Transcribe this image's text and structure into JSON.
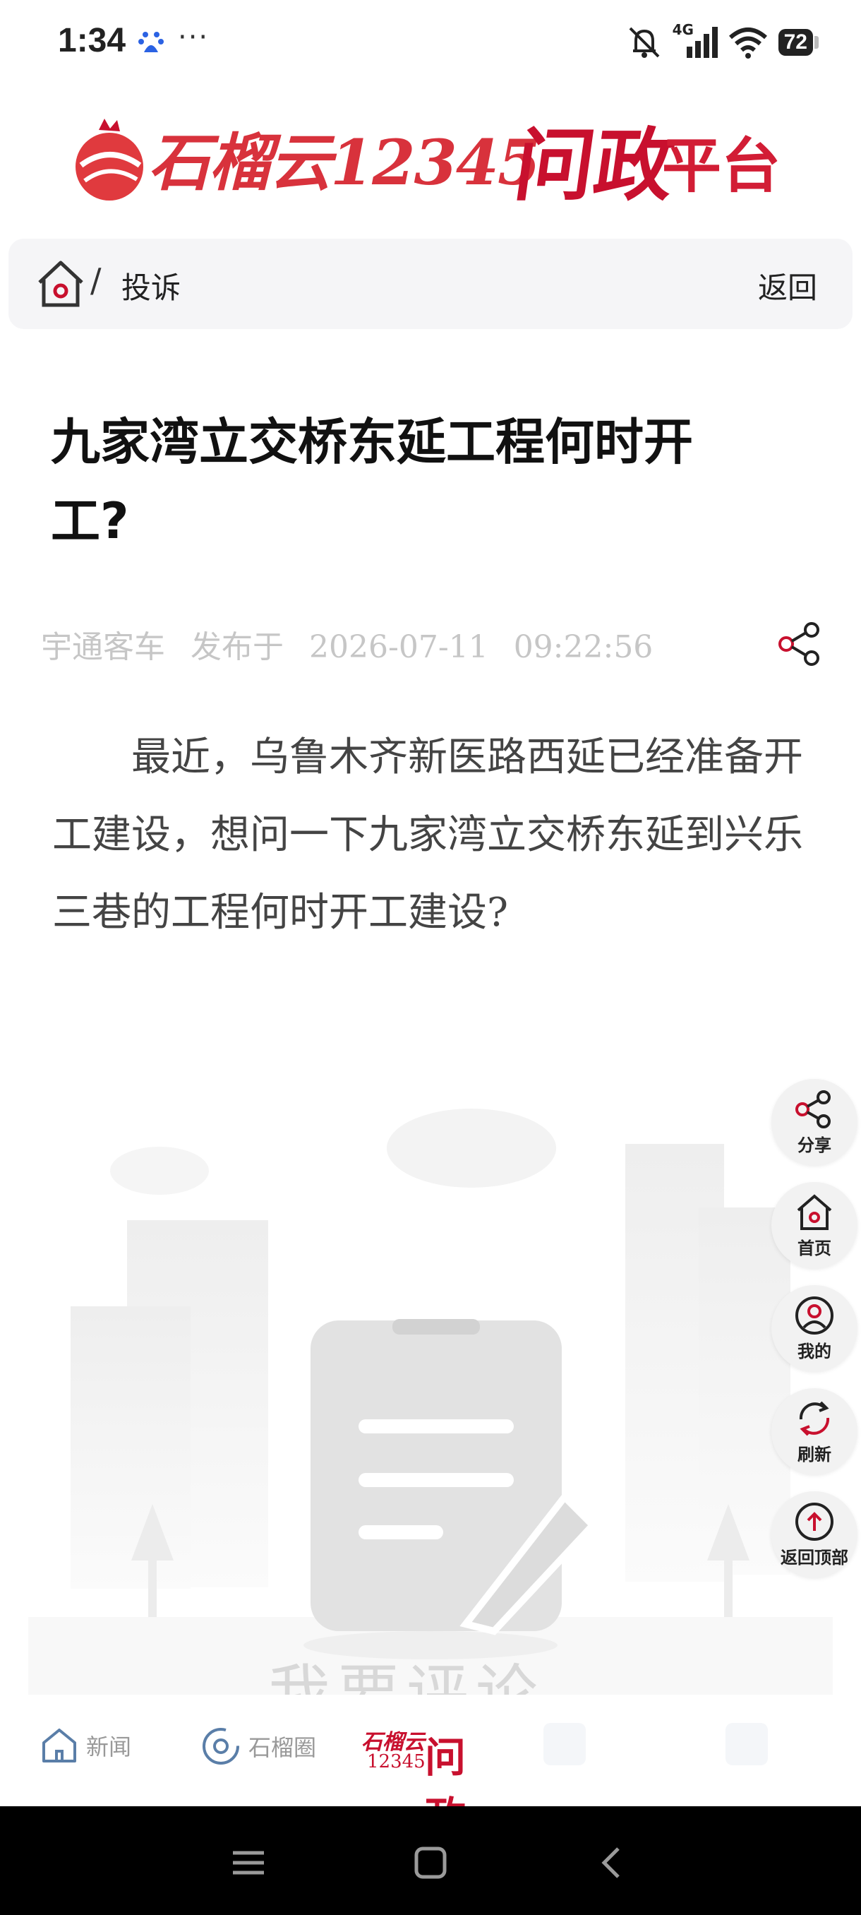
{
  "status_bar": {
    "time": "1:34",
    "notification_dots": "···",
    "network_label": "4G",
    "battery_level": "72",
    "icons": [
      "baidu-icon",
      "mute-icon",
      "signal-icon",
      "wifi-icon",
      "battery-icon"
    ]
  },
  "logo": {
    "brand": "石榴云12345",
    "highlight": "问政",
    "suffix": "平台"
  },
  "breadcrumb": {
    "separator": "/",
    "current": "投诉",
    "back_label": "返回"
  },
  "article": {
    "title": "九家湾立交桥东延工程何时开工?",
    "author": "宇通客车",
    "published_label": "发布于",
    "date": "2026-07-11",
    "time": "09:22:56",
    "body": "最近，乌鲁木齐新医路西延已经准备开工建设，想问一下九家湾立交桥东延到兴乐三巷的工程何时开工建设?"
  },
  "comment_hint": "我要评论",
  "float_buttons": {
    "share": "分享",
    "home": "首页",
    "mine": "我的",
    "refresh": "刷新",
    "top": "返回顶部"
  },
  "tab_bar": {
    "news": "新闻",
    "circle": "石榴圈",
    "active_small": "石榴云",
    "active_num": "12345",
    "active_big": "问政"
  },
  "colors": {
    "brand_red": "#c8102e",
    "meta_gray": "#c6c6c6"
  }
}
